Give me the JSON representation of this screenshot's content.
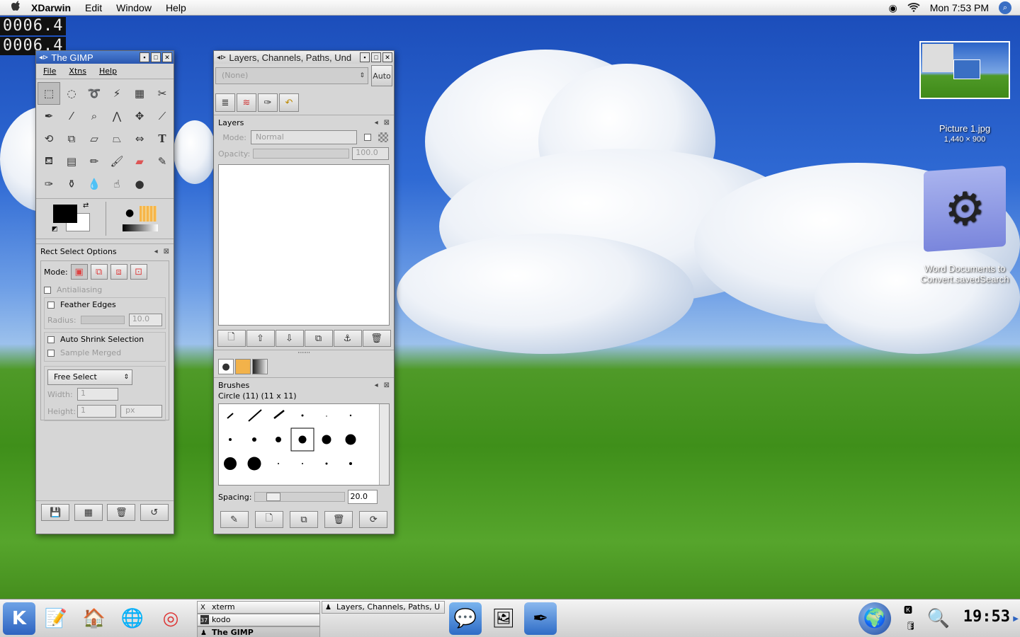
{
  "menubar": {
    "apple": "",
    "app_name": "XDarwin",
    "items": [
      "Edit",
      "Window",
      "Help"
    ],
    "clock": "Mon 7:53 PM"
  },
  "counters": [
    "0006.4",
    "0006.4"
  ],
  "gimp": {
    "title": "The GIMP",
    "menu": [
      "File",
      "Xtns",
      "Help"
    ],
    "tool_options_title": "Rect Select Options",
    "mode_label": "Mode:",
    "antialiasing": "Antialiasing",
    "feather_edges": "Feather Edges",
    "radius_label": "Radius:",
    "radius_value": "10.0",
    "auto_shrink": "Auto Shrink Selection",
    "sample_merged": "Sample Merged",
    "free_select": "Free Select",
    "width_label": "Width:",
    "width_value": "1",
    "height_label": "Height:",
    "height_value": "1",
    "unit": "px"
  },
  "layers": {
    "title": "Layers, Channels, Paths, Und",
    "image_select": "(None)",
    "auto_button": "Auto",
    "panel_title": "Layers",
    "mode_label": "Mode:",
    "mode_value": "Normal",
    "opacity_label": "Opacity:",
    "opacity_value": "100.0",
    "brushes_title": "Brushes",
    "brush_name": "Circle (11) (11 x 11)",
    "spacing_label": "Spacing:",
    "spacing_value": "20.0"
  },
  "desktop": {
    "picture_name": "Picture 1.jpg",
    "picture_size": "1,440 × 900",
    "folder_name_1": "Word Documents to",
    "folder_name_2": "Convert.savedSearch"
  },
  "taskbar": {
    "tasks": [
      {
        "label": "xterm",
        "icon": "X"
      },
      {
        "label": "kodo",
        "icon": "37"
      },
      {
        "label": "The GIMP",
        "icon": "♟"
      },
      {
        "label": "Layers, Channels, Paths, U",
        "icon": "♟"
      }
    ],
    "clock": "19:53"
  }
}
